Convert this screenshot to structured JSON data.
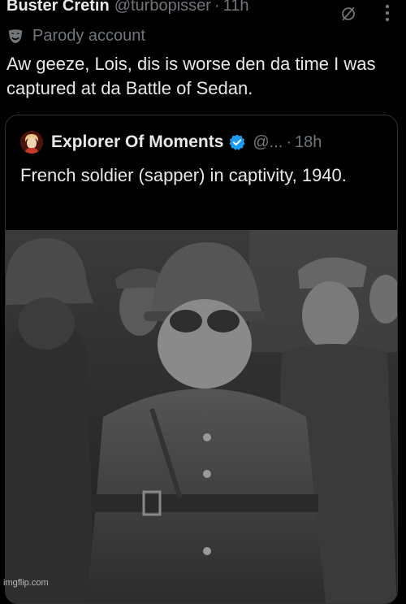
{
  "post": {
    "author_name": "Buster Cretin",
    "author_handle": "@turbopisser",
    "separator": "·",
    "time": "11h",
    "badge_label": "Parody account",
    "text": "Aw geeze, Lois, dis is worse den da time I was captured at da Battle of Sedan."
  },
  "quote": {
    "author_name": "Explorer Of Moments",
    "author_handle": "@...",
    "separator": "·",
    "time": "18h",
    "text": "French soldier (sapper) in captivity, 1940."
  },
  "watermark": "imgflip.com",
  "colors": {
    "background": "#000000",
    "text_primary": "#e7e9ea",
    "text_secondary": "#71767b",
    "border": "#2f3336",
    "verified": "#1d9bf0"
  },
  "icons": {
    "grok": "grok-icon",
    "more": "more-icon",
    "parody": "parody-mask-icon",
    "verified": "verified-badge-icon"
  }
}
